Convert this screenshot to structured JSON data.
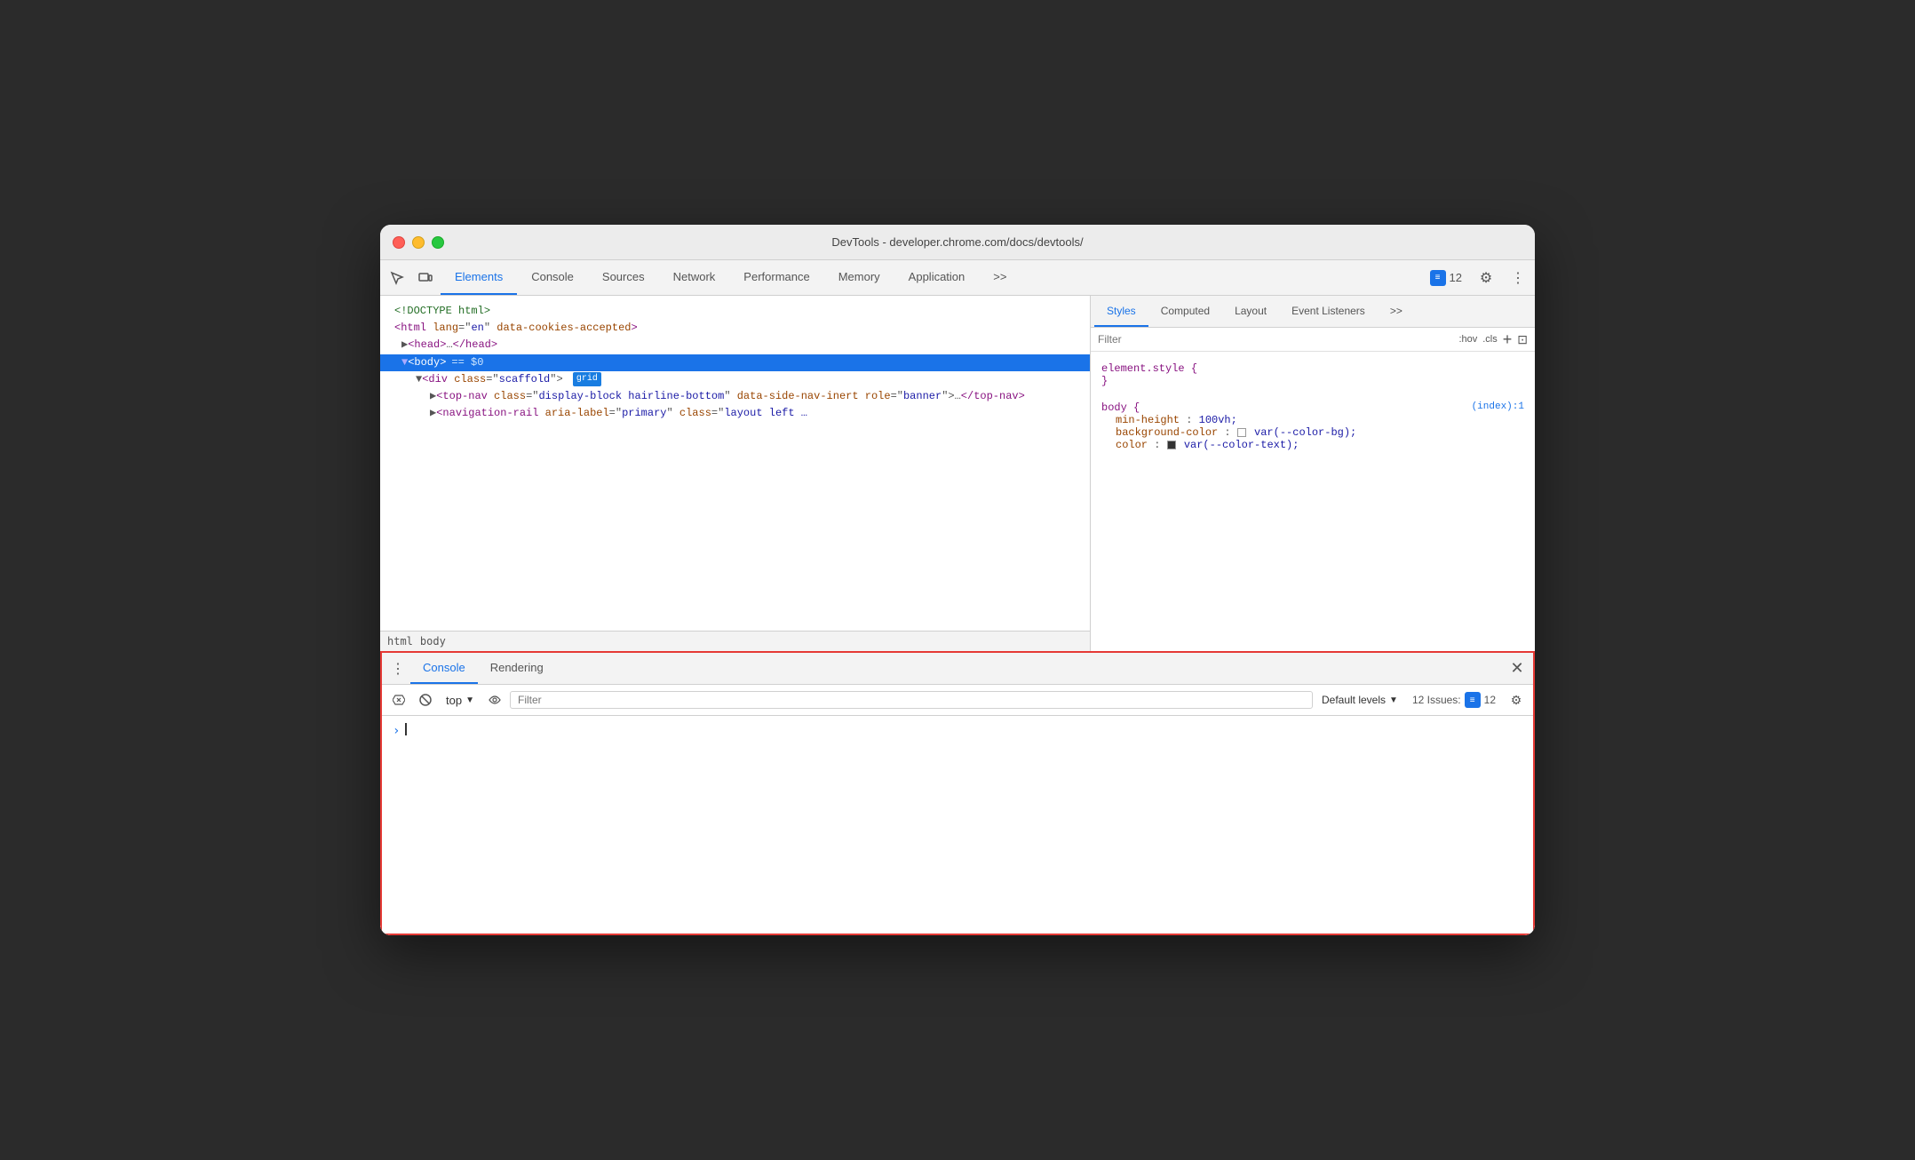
{
  "window": {
    "title": "DevTools - developer.chrome.com/docs/devtools/"
  },
  "toolbar": {
    "tabs": [
      {
        "id": "elements",
        "label": "Elements",
        "active": true
      },
      {
        "id": "console",
        "label": "Console",
        "active": false
      },
      {
        "id": "sources",
        "label": "Sources",
        "active": false
      },
      {
        "id": "network",
        "label": "Network",
        "active": false
      },
      {
        "id": "performance",
        "label": "Performance",
        "active": false
      },
      {
        "id": "memory",
        "label": "Memory",
        "active": false
      },
      {
        "id": "application",
        "label": "Application",
        "active": false
      }
    ],
    "issues_label": "12",
    "more_tabs": ">>"
  },
  "dom_tree": {
    "lines": [
      {
        "text": "<!DOCTYPE html>",
        "type": "comment",
        "indent": 0
      },
      {
        "text": "<html lang=\"en\" data-cookies-accepted>",
        "type": "tag",
        "indent": 0
      },
      {
        "text": "▶<head>…</head>",
        "type": "tag",
        "indent": 1
      },
      {
        "text": "▼<body> == $0",
        "type": "tag-selected",
        "indent": 1
      },
      {
        "text": "▼<div class=\"scaffold\"> grid",
        "type": "tag",
        "indent": 2,
        "badge": "grid"
      },
      {
        "text": "▶<top-nav class=\"display-block hairline-bottom\" data-side-nav-inert role=\"banner\">…</top-nav>",
        "type": "tag",
        "indent": 3
      },
      {
        "text": "▶<navigation-rail aria-label=\"primary\" class=\"layout left …",
        "type": "tag",
        "indent": 3
      }
    ]
  },
  "breadcrumb": {
    "items": [
      "html",
      "body"
    ]
  },
  "styles_panel": {
    "tabs": [
      {
        "id": "styles",
        "label": "Styles",
        "active": true
      },
      {
        "id": "computed",
        "label": "Computed",
        "active": false
      },
      {
        "id": "layout",
        "label": "Layout",
        "active": false
      },
      {
        "id": "event-listeners",
        "label": "Event Listeners",
        "active": false
      }
    ],
    "filter_placeholder": "Filter",
    "hov_label": ":hov",
    "cls_label": ".cls",
    "rules": [
      {
        "selector": "element.style {",
        "closing": "}",
        "source": "",
        "properties": []
      },
      {
        "selector": "body {",
        "closing": "}",
        "source": "(index):1",
        "properties": [
          {
            "prop": "min-height",
            "value": "100vh;"
          },
          {
            "prop": "background-color",
            "value": "var(--color-bg);",
            "swatch": "#ffffff"
          },
          {
            "prop": "color",
            "value": "var(--color-text);",
            "swatch": "#333333"
          }
        ]
      }
    ]
  },
  "console_drawer": {
    "tabs": [
      {
        "id": "console-tab",
        "label": "Console",
        "active": true
      },
      {
        "id": "rendering",
        "label": "Rendering",
        "active": false
      }
    ],
    "toolbar": {
      "context": "top",
      "filter_placeholder": "Filter",
      "levels_label": "Default levels",
      "issues_count": "12 Issues:",
      "issues_badge": "12"
    }
  }
}
